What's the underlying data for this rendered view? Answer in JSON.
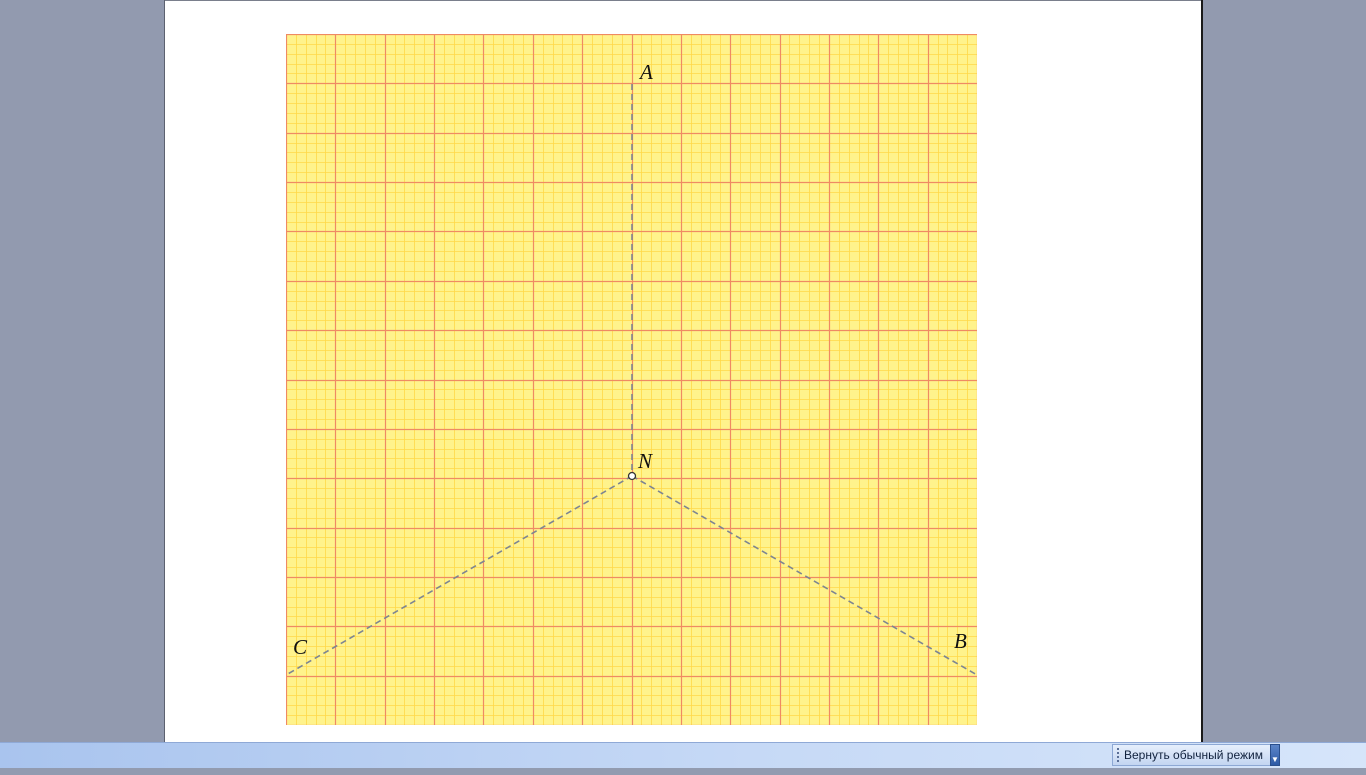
{
  "figure": {
    "points": {
      "A": "A",
      "B": "B",
      "C": "C",
      "N": "N"
    },
    "colors": {
      "paper": "#fff38c",
      "fine_grid": "#ffd94a",
      "major_grid": "#ef8a63",
      "dashed_line": "#7d8592"
    }
  },
  "statusbar": {
    "restore_mode_label": "Вернуть обычный режим"
  }
}
